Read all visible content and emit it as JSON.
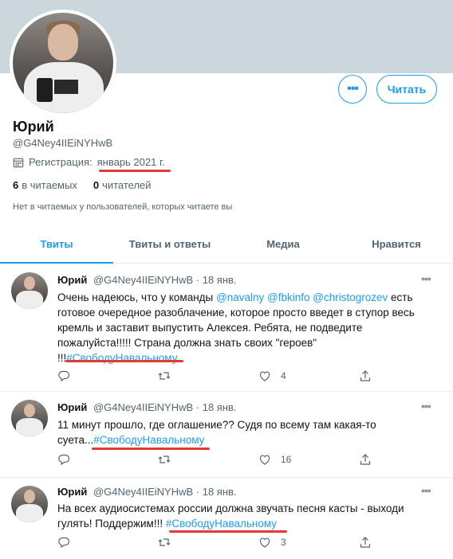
{
  "profile": {
    "name": "Юрий",
    "handle": "@G4Ney4IIEiNYHwB",
    "joined_prefix": "Регистрация:",
    "joined_date": "январь 2021 г.",
    "following_count": "6",
    "following_label": "в читаемых",
    "followers_count": "0",
    "followers_label": "читателей",
    "notice": "Нет в читаемых у пользователей, которых читаете вы",
    "more_button": "•••",
    "follow_button": "Читать"
  },
  "tabs": [
    {
      "label": "Твиты"
    },
    {
      "label": "Твиты и ответы"
    },
    {
      "label": "Медиа"
    },
    {
      "label": "Нравится"
    }
  ],
  "tweets": [
    {
      "name": "Юрий",
      "handle": "@G4Ney4IIEiNYHwB",
      "date": "· 18 янв.",
      "more": "•••",
      "text_a": "Очень надеюсь, что у команды ",
      "mention1": "@navalny",
      "mention2": "@fbkinfo",
      "mention3": "@christogrozev",
      "text_b": " есть готовое очередное разоблачение, которое просто введет в ступор весь кремль и заставит выпустить Алексея. Ребята, не подведите пожалуйста!!!!! Страна должна знать своих \"героев\" !!!",
      "hashtag": "#СвободуНавальному",
      "likes": "4"
    },
    {
      "name": "Юрий",
      "handle": "@G4Ney4IIEiNYHwB",
      "date": "· 18 янв.",
      "more": "•••",
      "text_a": "11 минут прошло, где оглашение?? Судя по всему там какая-то суета...",
      "hashtag": "#СвободуНавальному",
      "likes": "16"
    },
    {
      "name": "Юрий",
      "handle": "@G4Ney4IIEiNYHwB",
      "date": "· 18 янв.",
      "more": "•••",
      "text_a": "На всех аудиосистемах россии должна звучать песня касты - выходи гулять! Поддержим!!! ",
      "hashtag": "#СвободуНавальному",
      "likes": "3"
    }
  ],
  "colors": {
    "accent": "#1d9bf0",
    "highlight": "#e53935",
    "banner": "#ccd6dd"
  }
}
